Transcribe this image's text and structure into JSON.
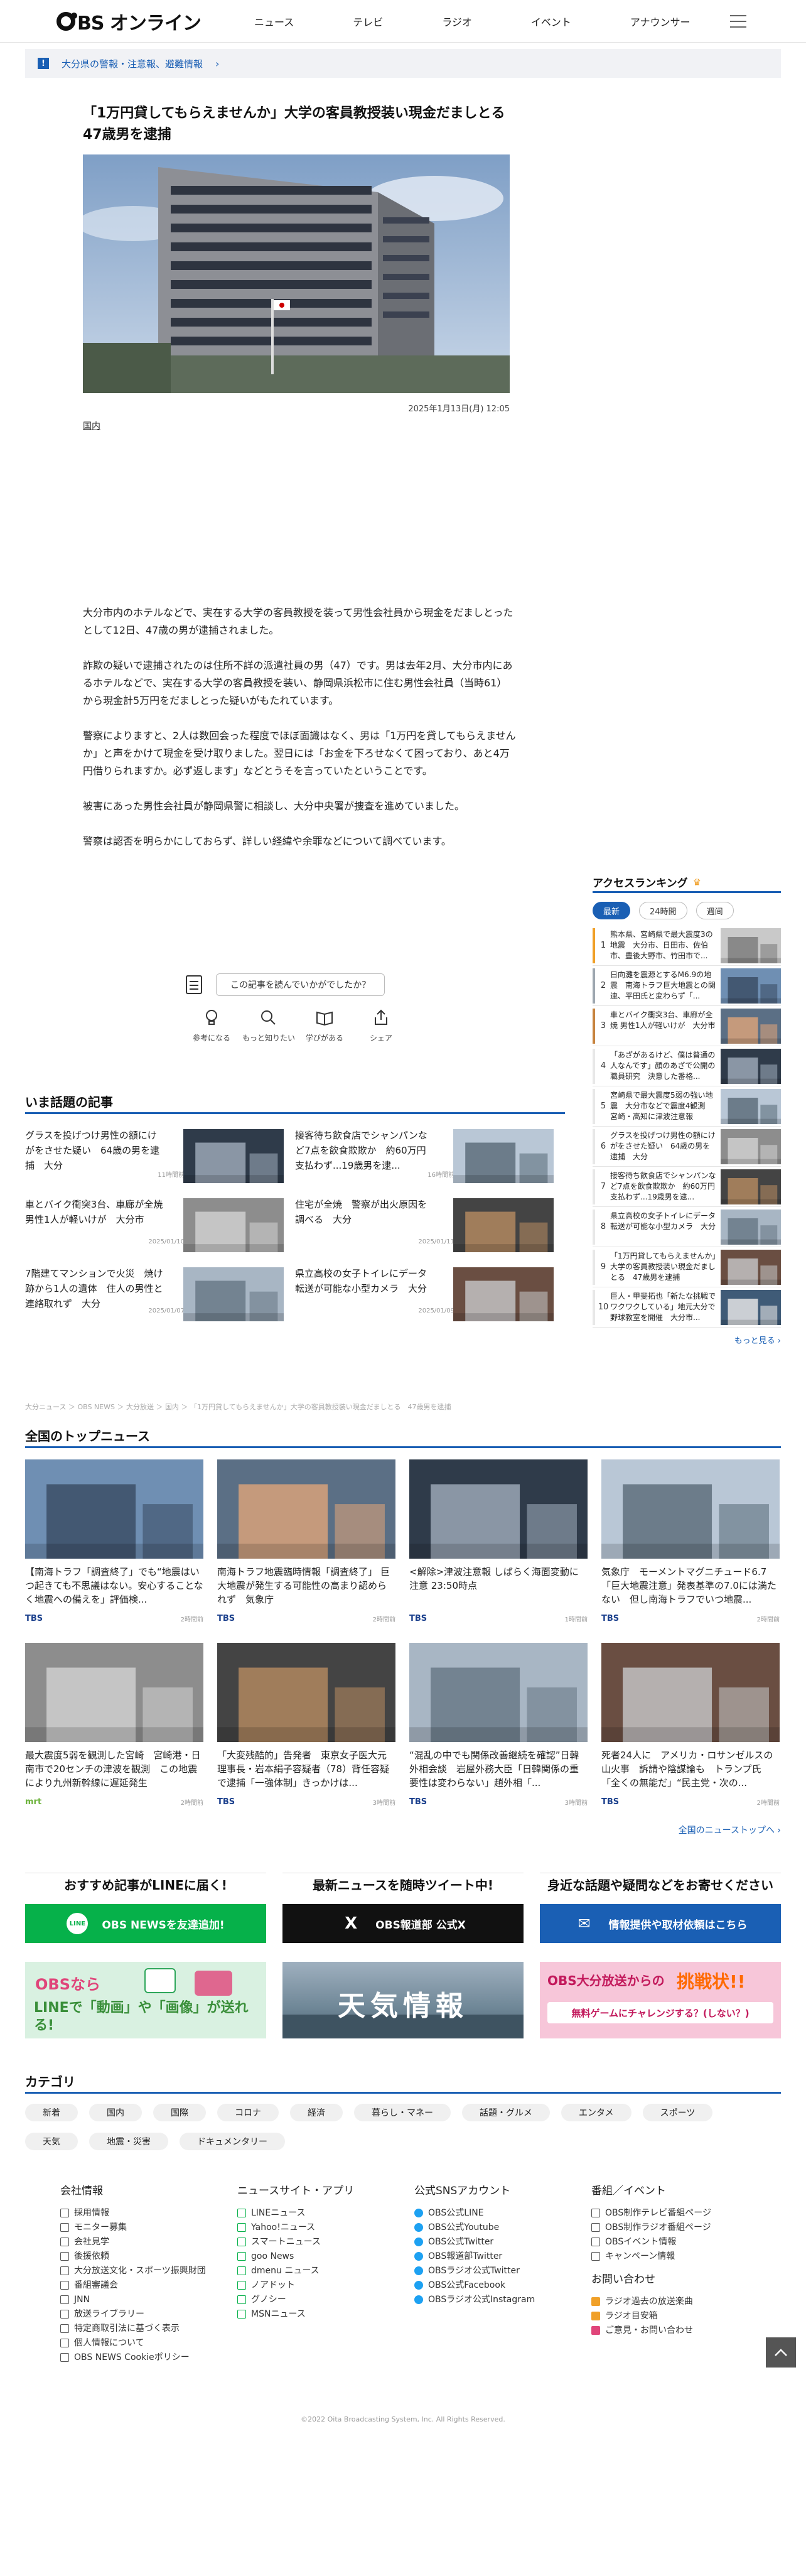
{
  "header": {
    "logo": "BS オンライン",
    "nav": [
      "ニュース",
      "テレビ",
      "ラジオ",
      "イベント",
      "アナウンサー"
    ]
  },
  "alert": {
    "icon": "!",
    "text": "大分県の警報・注意報、避難情報",
    "chevron": "›"
  },
  "article": {
    "title": "「1万円貸してもらえませんか」大学の客員教授装い現金だましとる　47歳男を逮捕",
    "date": "2025年1月13日(月) 12:05",
    "category": "国内",
    "paragraphs": [
      "大分市内のホテルなどで、実在する大学の客員教授を装って男性会社員から現金をだましとったとして12日、47歳の男が逮捕されました。",
      "詐欺の疑いで逮捕されたのは住所不詳の派遣社員の男（47）です。男は去年2月、大分市内にあるホテルなどで、実在する大学の客員教授を装い、静岡県浜松市に住む男性会社員（当時61）から現金計5万円をだましとった疑いがもたれています。",
      "警察によりますと、2人は数回会った程度でほぼ面識はなく、男は「1万円を貸してもらえませんか」と声をかけて現金を受け取りました。翌日には「お金を下ろせなくて困っており、あと4万円借りられますか。必ず返します」などとうそを言っていたということです。",
      "被害にあった男性会社員が静岡県警に相談し、大分中央署が捜査を進めていました。",
      "警察は認否を明らかにしておらず、詳しい経緯や余罪などについて調べています。"
    ],
    "survey": "この記事を読んでいかがでしたか？",
    "reactions": [
      "参考になる",
      "もっと知りたい",
      "学びがある",
      "シェア"
    ]
  },
  "ranking": {
    "title": "アクセスランキング",
    "tabs": [
      "最新",
      "24時間",
      "週间"
    ],
    "items": [
      {
        "num": "1",
        "text": "熊本県、宮崎県で最大震度3の地震　大分市、日田市、佐伯市、豊後大野市、竹田市で..."
      },
      {
        "num": "2",
        "text": "日向灘を震源とするM6.9の地震　南海トラフ巨大地震との関連、平田氏と変わらず「..."
      },
      {
        "num": "3",
        "text": "車とバイク衝突3台、車廊が全焼 男性1人が軽いけが　大分市"
      },
      {
        "num": "4",
        "text": "「あざがあるけど、僕は普通の人なんです」顔のあざで公開の職員研究　決意した番格..."
      },
      {
        "num": "5",
        "text": "宮崎県で最大震度5弱の強い地震　大分市などで震度4観測　宮崎・高知に津波注意報"
      },
      {
        "num": "6",
        "text": "グラスを投げつけ男性の額にけがをさせた疑い　64歳の男を逮捕　大分"
      },
      {
        "num": "7",
        "text": "接客待ち飲食店でシャンパンなど7点を飲食欺欺か　約60万円支払わず...19歳男を逮..."
      },
      {
        "num": "8",
        "text": "県立高校の女子トイレにデータ転送が可能な小型カメラ　大分"
      },
      {
        "num": "9",
        "text": "「1万円貸してもらえませんか」大学の客員教授装い現金だましとる　47歳男を逮捕"
      },
      {
        "num": "10",
        "text": "巨人・甲斐拓也「新たな挑戦でワクワクしている」地元大分で野球教室を開催　大分市..."
      }
    ],
    "more": "もっと見る ›"
  },
  "hot": {
    "title": "いま話題の記事",
    "items": [
      {
        "text": "グラスを投げつけ男性の額にけがをさせた疑い　64歳の男を逮捕　大分",
        "date": "11時間前"
      },
      {
        "text": "接客待ち飲食店でシャンパンなど7点を飲食欺欺か　約60万円支払わず...19歳男を逮...",
        "date": "16時間前"
      },
      {
        "text": "車とバイク衝突3台、車廊が全焼 男性1人が軽いけが　大分市",
        "date": "2025/01/10"
      },
      {
        "text": "住宅が全焼　警察が出火原因を調べる　大分",
        "date": "2025/01/11"
      },
      {
        "text": "7階建てマンションで火災　焼け跡から1人の遺体　住人の男性と連絡取れず　大分",
        "date": "2025/01/07"
      },
      {
        "text": "県立高校の女子トイレにデータ転送が可能な小型カメラ　大分",
        "date": "2025/01/09"
      }
    ]
  },
  "breadcrumb": "大分ニュース ＞ OBS NEWS ＞ 大分放送 ＞ 国内 ＞ 「1万円貸してもらえませんか」大学の客員教授装い現金だましとる　47歳男を逮捕",
  "national": {
    "title": "全国のトップニュース",
    "items": [
      {
        "text": "【南海トラフ「調査終了」でも“地震はいつ起きても不思議はない。安心することなく地震への備えを」評価検...",
        "src": "TBS",
        "time": "2時間前"
      },
      {
        "text": "南海トラフ地震臨時情報「調査終了」 巨大地震が発生する可能性の高まり認められず　気象庁",
        "src": "TBS",
        "time": "2時間前"
      },
      {
        "text": "<解除>津波注意報 しばらく海面変動に注意 23:50時点",
        "src": "TBS",
        "time": "1時間前"
      },
      {
        "text": "気象庁　モーメントマグニチュード6.7「巨大地震注意」発表基準の7.0には満たない　但し南海トラフでいつ地震...",
        "src": "TBS",
        "time": "2時間前"
      },
      {
        "text": "最大震度5弱を観測した宮崎　宮崎港・日南市で20センチの津波を観測　この地震により九州新幹線に遅延発生",
        "src": "mrt",
        "time": "2時間前"
      },
      {
        "text": "「大変残酷的」告発者　東京女子医大元理事長・岩本絹子容疑者（78）背任容疑で逮捕「一強体制」きっかけは...",
        "src": "TBS",
        "time": "3時間前"
      },
      {
        "text": "“混乱の中でも関係改善継続を確認”日韓外相会談　岩屋外務大臣「日韓関係の重要性は変わらない」趙外相「...",
        "src": "TBS",
        "time": "3時間前"
      },
      {
        "text": "死者24人に　アメリカ・ロサンゼルスの山火事　訴請や陰謀論も　トランプ氏「全くの無能だ」“民主党・次の...",
        "src": "TBS",
        "time": "2時間前"
      }
    ],
    "more": "全国のニューストップへ ›"
  },
  "promos": [
    {
      "head": "おすすめ記事がLINEに届く!",
      "btn": "OBS NEWSを友達追加!",
      "icon": "LINE"
    },
    {
      "head": "最新ニュースを随時ツイート中!",
      "btn": "OBS報道部 公式X",
      "icon": "X"
    },
    {
      "head": "身近な話題や疑問などをお寄せください",
      "btn": "情報提供や取材依頼はこちら",
      "icon": "✉"
    }
  ],
  "banners": {
    "line": {
      "obs": "OBSなら",
      "sub": "LINEで「動画」や「画像」が送れる!"
    },
    "weather": "天気情報",
    "game": {
      "top": "OBS大分放送からの",
      "accent": "挑戦状!!",
      "sub": "無料ゲームにチャレンジする？(しない？)"
    }
  },
  "categories": {
    "title": "カテゴリ",
    "items": [
      "新着",
      "国内",
      "国際",
      "コロナ",
      "経済",
      "暮らし・マネー",
      "話題・グルメ",
      "エンタメ",
      "スポーツ",
      "天気",
      "地震・災害",
      "ドキュメンタリー"
    ]
  },
  "footer": {
    "cols": [
      {
        "title": "会社情報",
        "items": [
          "採用情報",
          "モニター募集",
          "会社見学",
          "後援依頼",
          "大分放送文化・スポーツ振興財団",
          "番組審議会",
          "JNN",
          "放送ライブラリー",
          "特定商取引法に基づく表示",
          "個人情報について",
          "OBS NEWS Cookieポリシー"
        ]
      },
      {
        "title": "ニュースサイト・アプリ",
        "items": [
          "LINEニュース",
          "Yahoo!ニュース",
          "スマートニュース",
          "goo News",
          "dmenu ニュース",
          "ノアドット",
          "グノシー",
          "MSNニュース"
        ]
      },
      {
        "title": "公式SNSアカウント",
        "items": [
          "OBS公式LINE",
          "OBS公式Youtube",
          "OBS公式Twitter",
          "OBS報道部Twitter",
          "OBSラジオ公式Twitter",
          "OBS公式Facebook",
          "OBSラジオ公式Instagram"
        ]
      },
      {
        "title": "番組／イベント",
        "items": [
          "OBS制作テレビ番組ページ",
          "OBS制作ラジオ番組ページ",
          "OBSイベント情報",
          "キャンペーン情報"
        ],
        "title2": "お問い合わせ",
        "items2": [
          "ラジオ過去の放送楽曲",
          "ラジオ目安箱",
          "ご意見・お問い合わせ"
        ]
      }
    ],
    "copyright": "©2022 Oita Broadcasting System, Inc. All Rights Reserved."
  },
  "colors": {
    "accent": "#1a5fb4",
    "line": "#06b14a",
    "rank_gold": "#f0a028"
  }
}
